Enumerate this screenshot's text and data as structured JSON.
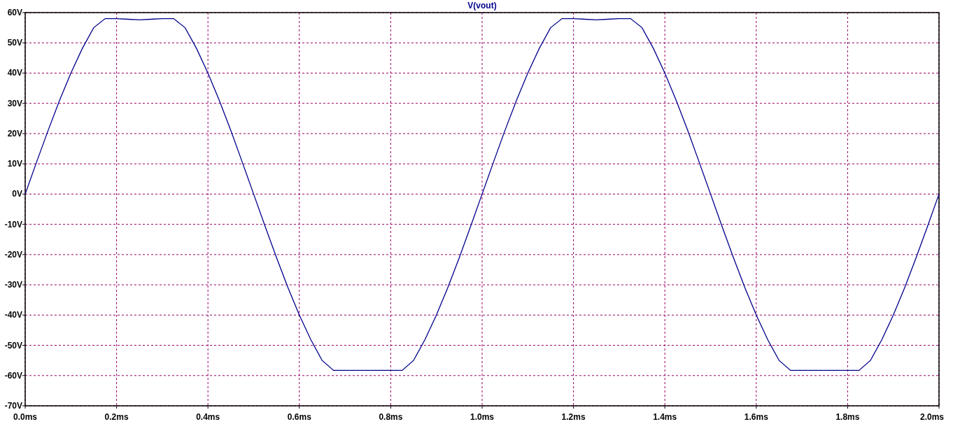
{
  "plot": {
    "chart_data": {
      "type": "line",
      "grid": true,
      "x": [
        0,
        0.025,
        0.05,
        0.075,
        0.1,
        0.125,
        0.15,
        0.175,
        0.2,
        0.225,
        0.25,
        0.275,
        0.3,
        0.325,
        0.35,
        0.375,
        0.4,
        0.425,
        0.45,
        0.475,
        0.5,
        0.525,
        0.55,
        0.575,
        0.6,
        0.625,
        0.65,
        0.675,
        0.7,
        0.725,
        0.75,
        0.775,
        0.8,
        0.825,
        0.85,
        0.875,
        0.9,
        0.925,
        0.95,
        0.975,
        1.0,
        1.025,
        1.05,
        1.075,
        1.1,
        1.125,
        1.15,
        1.175,
        1.2,
        1.225,
        1.25,
        1.275,
        1.3,
        1.325,
        1.35,
        1.375,
        1.4,
        1.425,
        1.45,
        1.475,
        1.5,
        1.525,
        1.55,
        1.575,
        1.6,
        1.625,
        1.65,
        1.675,
        1.7,
        1.725,
        1.75,
        1.775,
        1.8,
        1.825,
        1.85,
        1.875,
        1.9,
        1.925,
        1.95,
        1.975,
        2.0
      ],
      "series": [
        {
          "name": "V(vout)",
          "color": "#00008b",
          "values": [
            0,
            10.6,
            21,
            30.9,
            40,
            48.1,
            55,
            58,
            58,
            57.8,
            57.6,
            57.8,
            58,
            58,
            55,
            48.1,
            40,
            30.9,
            21,
            10.6,
            0,
            -10.6,
            -21,
            -30.9,
            -40,
            -48.1,
            -55,
            -58.3,
            -58.3,
            -58.3,
            -58.3,
            -58.3,
            -58.3,
            -58.3,
            -55,
            -48.1,
            -40,
            -30.9,
            -21,
            -10.6,
            0,
            10.6,
            21,
            30.9,
            40,
            48.1,
            55,
            58,
            58,
            57.8,
            57.6,
            57.8,
            58,
            58,
            55,
            48.1,
            40,
            30.9,
            21,
            10.6,
            0,
            -10.6,
            -21,
            -30.9,
            -40,
            -48.1,
            -55,
            -58.3,
            -58.3,
            -58.3,
            -58.3,
            -58.3,
            -58.3,
            -58.3,
            -55,
            -48.1,
            -40,
            -30.9,
            -21,
            -10.6,
            0
          ]
        }
      ],
      "xlim": [
        0,
        2
      ],
      "ylim": [
        -70,
        60
      ],
      "xticks": [
        {
          "value": 0,
          "label": "0.0ms"
        },
        {
          "value": 0.2,
          "label": "0.2ms"
        },
        {
          "value": 0.4,
          "label": "0.4ms"
        },
        {
          "value": 0.6,
          "label": "0.6ms"
        },
        {
          "value": 0.8,
          "label": "0.8ms"
        },
        {
          "value": 1.0,
          "label": "1.0ms"
        },
        {
          "value": 1.2,
          "label": "1.2ms"
        },
        {
          "value": 1.4,
          "label": "1.4ms"
        },
        {
          "value": 1.6,
          "label": "1.6ms"
        },
        {
          "value": 1.8,
          "label": "1.8ms"
        },
        {
          "value": 2.0,
          "label": "2.0ms"
        }
      ],
      "yticks": [
        {
          "value": 60,
          "label": "60V"
        },
        {
          "value": 50,
          "label": "50V"
        },
        {
          "value": 40,
          "label": "40V"
        },
        {
          "value": 30,
          "label": "30V"
        },
        {
          "value": 20,
          "label": "20V"
        },
        {
          "value": 10,
          "label": "10V"
        },
        {
          "value": 0,
          "label": "0V"
        },
        {
          "value": -10,
          "label": "-10V"
        },
        {
          "value": -20,
          "label": "-20V"
        },
        {
          "value": -30,
          "label": "-30V"
        },
        {
          "value": -40,
          "label": "-40V"
        },
        {
          "value": -50,
          "label": "-50V"
        },
        {
          "value": -60,
          "label": "-60V"
        },
        {
          "value": -70,
          "label": "-70V"
        }
      ]
    }
  }
}
